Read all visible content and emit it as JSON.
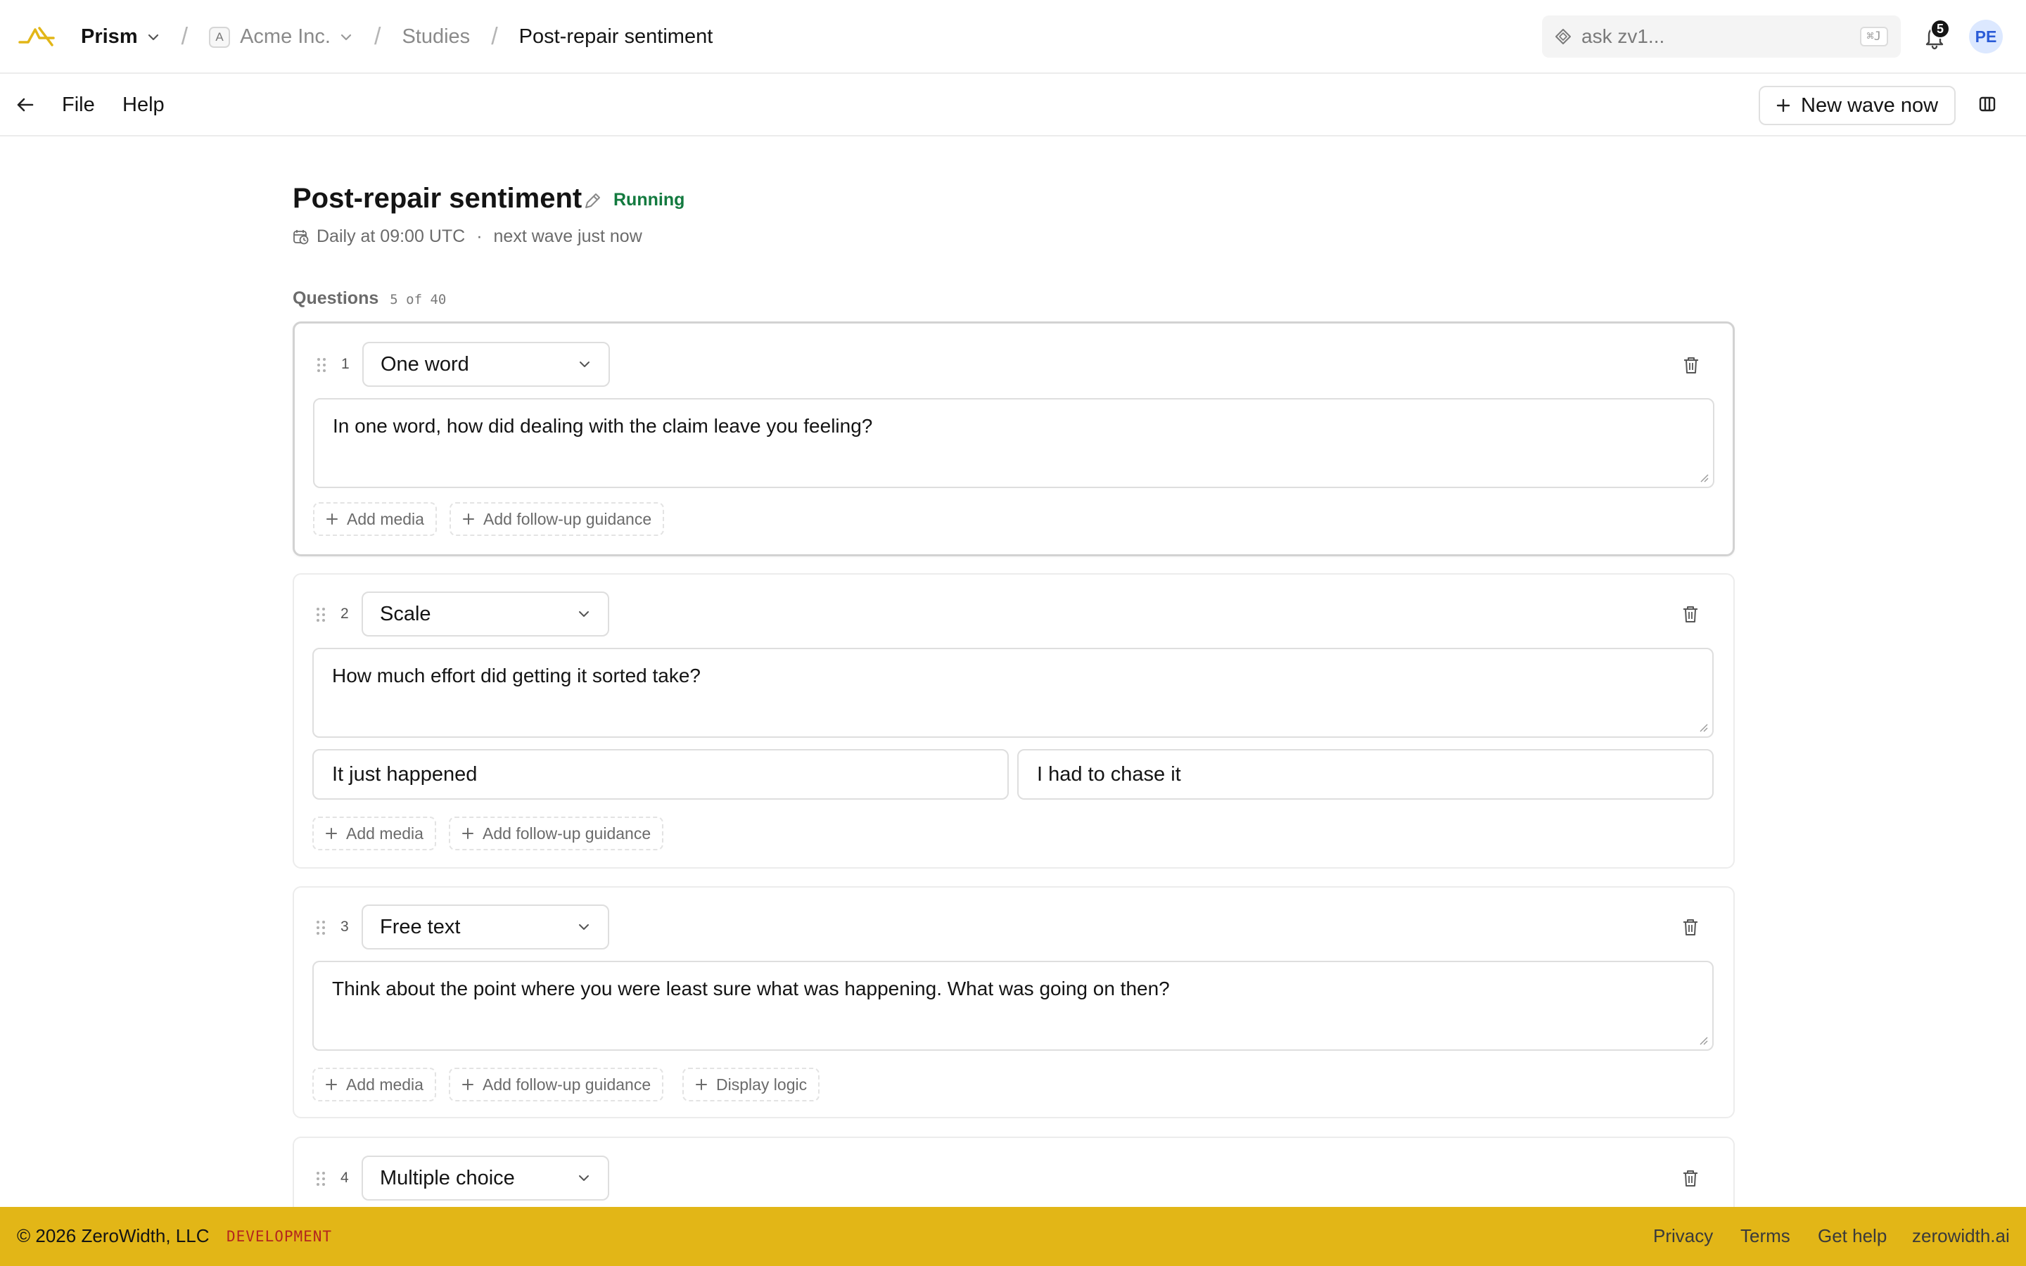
{
  "header": {
    "app_name": "Prism",
    "org_initial": "A",
    "org_name": "Acme Inc.",
    "breadcrumb_studies": "Studies",
    "breadcrumb_current": "Post-repair sentiment",
    "ask_placeholder": "ask zv1...",
    "ask_shortcut": "⌘J",
    "notification_count": "5",
    "user_initials": "PE"
  },
  "toolbar": {
    "file_label": "File",
    "help_label": "Help",
    "new_wave_label": "New wave now"
  },
  "study": {
    "title": "Post-repair sentiment",
    "status": "Running",
    "schedule": "Daily at 09:00 UTC",
    "separator": "·",
    "next_wave": "next wave just now"
  },
  "questions_section": {
    "label": "Questions",
    "count": "5 of 40"
  },
  "questions": [
    {
      "number": "1",
      "type": "One word",
      "prompt": "In one word, how did dealing with the claim leave you feeling?",
      "actions": [
        "Add media",
        "Add follow-up guidance"
      ]
    },
    {
      "number": "2",
      "type": "Scale",
      "prompt": "How much effort did getting it sorted take?",
      "scale_low": "It just happened",
      "scale_high": "I had to chase it",
      "actions": [
        "Add media",
        "Add follow-up guidance"
      ]
    },
    {
      "number": "3",
      "type": "Free text",
      "prompt": "Think about the point where you were least sure what was happening. What was going on then?",
      "actions": [
        "Add media",
        "Add follow-up guidance",
        "Display logic"
      ]
    },
    {
      "number": "4",
      "type": "Multiple choice"
    }
  ],
  "footer": {
    "copyright": "© 2026 ZeroWidth, LLC",
    "environment": "DEVELOPMENT",
    "links": [
      "Privacy",
      "Terms",
      "Get help",
      "zerowidth.ai"
    ]
  },
  "colors": {
    "status_running": "#137a3f",
    "footer_bg": "#e2b617",
    "environment_text": "#b3261e",
    "logo_accent": "#e2b617",
    "avatar_bg": "#dce8ff"
  },
  "icons": {
    "logo": "zerowidth-logo-icon",
    "chevron": "chevron-down-icon",
    "ask": "diamond-sparkle-icon",
    "notifications": "bell-icon",
    "back": "arrow-left-icon",
    "add": "plus-icon",
    "panel": "panel-toggle-icon",
    "edit": "pencil-icon",
    "schedule": "calendar-clock-icon",
    "drag": "drag-handle-icon",
    "delete": "trash-icon"
  }
}
